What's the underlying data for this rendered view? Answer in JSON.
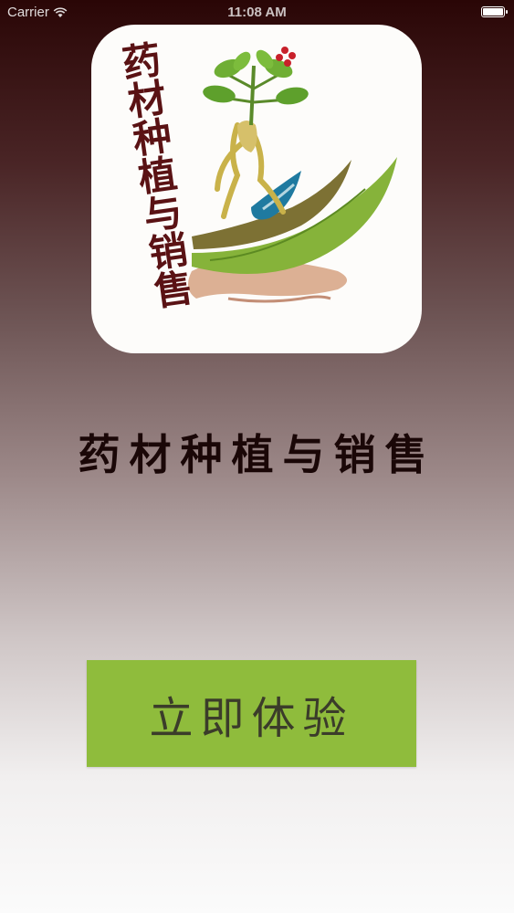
{
  "status_bar": {
    "carrier": "Carrier",
    "time": "11:08 AM",
    "battery_level": 1.0
  },
  "logo": {
    "icon_name": "herb-hand-logo-icon",
    "vertical_text": "药材种植与销售"
  },
  "app_title": "药材种植与销售",
  "start_button": {
    "label": "立即体验"
  },
  "colors": {
    "button_green": "#8fbc3c",
    "title_dark": "#1a0707"
  }
}
